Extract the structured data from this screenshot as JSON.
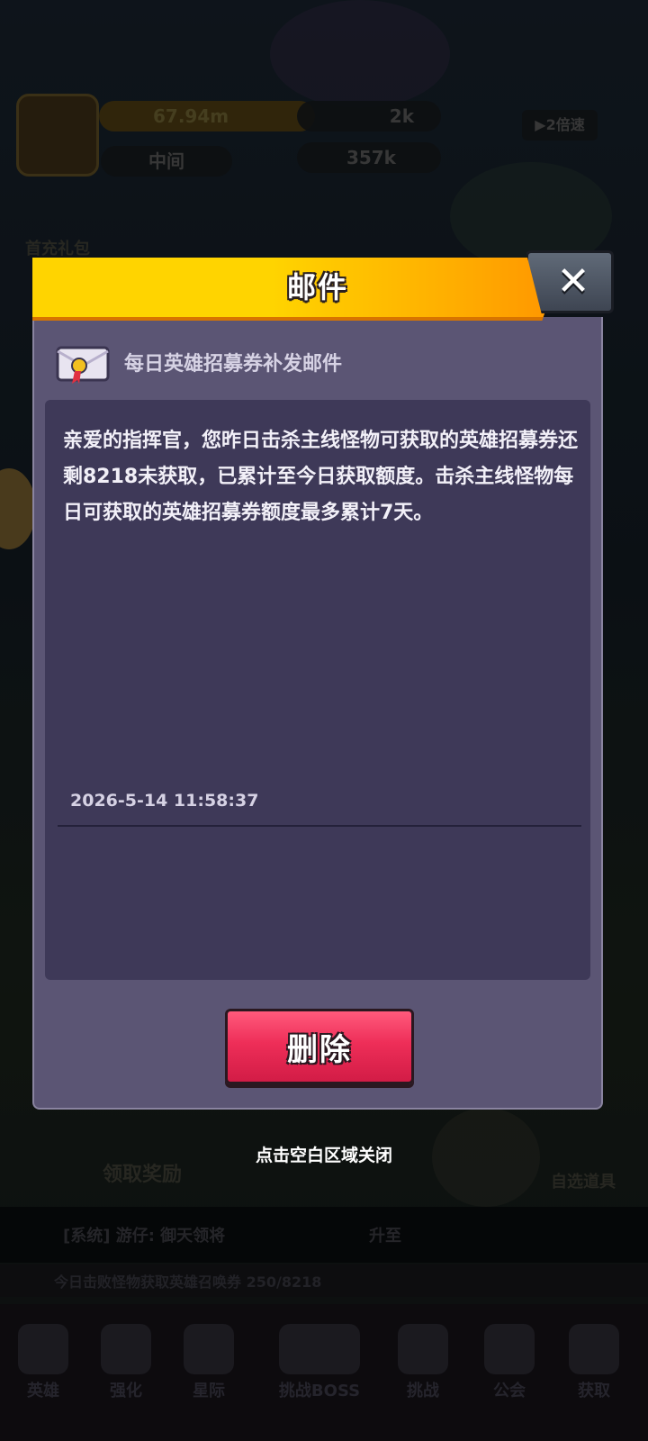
{
  "background": {
    "hud_pill_1": "67.94m",
    "hud_pill_2": "中间",
    "hud_gems": "2k",
    "hud_coins": "357k",
    "hud_speed": "▶2倍速",
    "gift_label": "首充礼包",
    "reward_label": "领取奖励",
    "auto_label": "自选道具",
    "chat_line": "[系统] 游仔: 御天领将",
    "chat_line_suffix": "升至",
    "task_line": "今日击败怪物获取英雄召唤券 250/8218",
    "nav": [
      "英雄",
      "强化",
      "星际",
      "挑战BOSS",
      "挑战",
      "公会",
      "获取"
    ]
  },
  "dialog": {
    "title": "邮件",
    "close_icon": "close-icon",
    "mail_title": "每日英雄招募券补发邮件",
    "content": "亲爱的指挥官，您昨日击杀主线怪物可获取的英雄招募券还剩8218未获取，已累计至今日获取额度。击杀主线怪物每日可获取的英雄招募券额度最多累计7天。",
    "date": "2026-5-14 11:58:37",
    "delete_label": "删除"
  },
  "close_hint": "点击空白区域关闭",
  "colors": {
    "header_yellow": "#ffd400",
    "header_orange": "#ff9400",
    "panel_bg": "#5b5574",
    "content_bg": "#3e3958",
    "delete_red": "#ee2e58"
  }
}
